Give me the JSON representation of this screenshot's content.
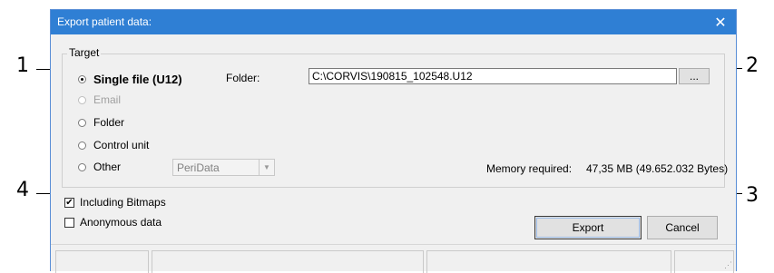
{
  "window": {
    "title": "Export patient data:",
    "close_icon": "close-icon"
  },
  "target_group": {
    "legend": "Target",
    "options": [
      {
        "label": "Single file (U12)",
        "selected": true,
        "enabled": true
      },
      {
        "label": "Email",
        "selected": false,
        "enabled": false
      },
      {
        "label": "Folder",
        "selected": false,
        "enabled": true
      },
      {
        "label": "Control unit",
        "selected": false,
        "enabled": true
      },
      {
        "label": "Other",
        "selected": false,
        "enabled": true
      }
    ],
    "folder_label": "Folder:",
    "folder_value": "C:\\CORVIS\\190815_102548.U12",
    "browse_label": "...",
    "other_combo_value": "PeriData",
    "memory_label": "Memory required:",
    "memory_value": "47,35 MB (49.652.032 Bytes)"
  },
  "checkboxes": [
    {
      "label": "Including Bitmaps",
      "checked": true
    },
    {
      "label": "Anonymous data",
      "checked": false
    }
  ],
  "buttons": {
    "export": "Export",
    "cancel": "Cancel"
  },
  "callouts": [
    "1",
    "2",
    "3",
    "4"
  ]
}
